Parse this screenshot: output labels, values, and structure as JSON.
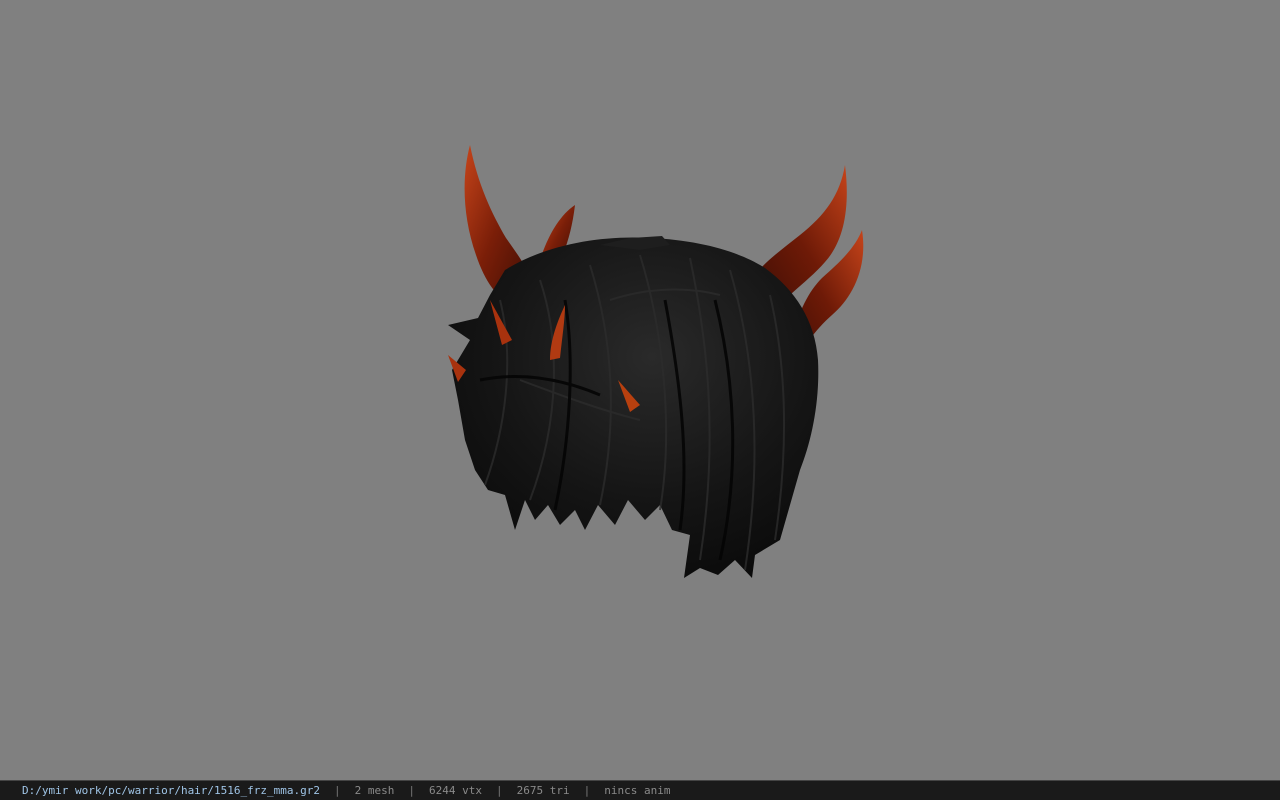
{
  "viewer": {
    "background_color": "#808080",
    "model_icon": "horned-hair-mesh"
  },
  "statusbar": {
    "file_path": "D:/ymir work/pc/warrior/hair/1516_frz_mma.gr2",
    "mesh_count": "2 mesh",
    "vertex_count": "6244 vtx",
    "triangle_count": "2675 tri",
    "anim_status": "nincs anim",
    "separator": "|"
  },
  "colors": {
    "hair": "#151515",
    "horn_dark": "#3a0d04",
    "horn_light": "#b8350f"
  }
}
